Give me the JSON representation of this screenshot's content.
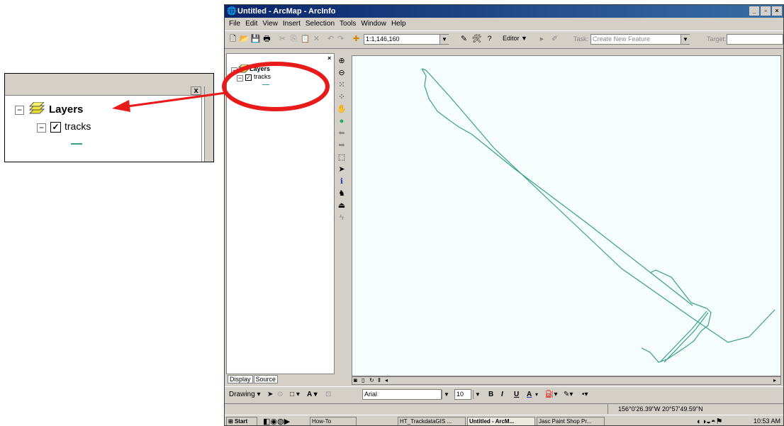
{
  "inset": {
    "close_glyph": "x",
    "layers_label": "Layers",
    "tracks_label": "tracks",
    "expand_glyph": "−",
    "check_glyph": "✓"
  },
  "window": {
    "title": "Untitled - ArcMap - ArcInfo",
    "controls": [
      "_",
      "▫",
      "×"
    ],
    "menus": [
      "File",
      "Edit",
      "View",
      "Insert",
      "Selection",
      "Tools",
      "Window",
      "Help"
    ],
    "toolbar": {
      "scale": "1:1,146,160",
      "editor_label": "Editor",
      "task_label": "Task:",
      "task_value": "Create New Feature",
      "target_label": "Target:"
    },
    "toc": {
      "layers_label": "Layers",
      "tracks_label": "tracks"
    },
    "tabs": [
      "Display",
      "Source"
    ],
    "drawing": {
      "label": "Drawing",
      "font": "Arial",
      "size": "10",
      "bold": "B",
      "italic": "I",
      "underline": "U",
      "font_color_glyph": "A"
    },
    "status": {
      "coords": "156°0'26.39\"W  20°57'49.59\"N"
    },
    "taskbar": {
      "start": "Start",
      "buttons": [
        "How-To",
        "HT_TrackdataGIS ...",
        "Untitled - ArcM...",
        "Jasc Paint Shop Pr..."
      ],
      "time": "10:53 AM"
    }
  },
  "colors": {
    "track": "#3a9f8a",
    "highlight": "#e81a1a",
    "titlebar": "#0a246a"
  }
}
